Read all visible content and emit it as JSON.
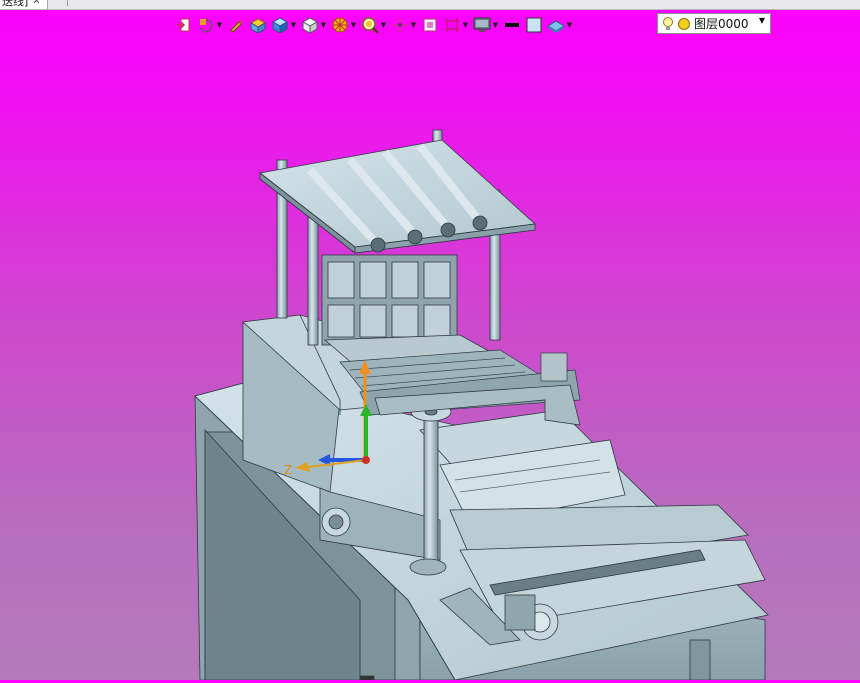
{
  "document_tab": {
    "title": "送线]",
    "close_glyph": "✕"
  },
  "layer_selector": {
    "value": "图层0000"
  },
  "colors": {
    "viewport_top": "#ff00ff",
    "viewport_bottom": "#b47aba",
    "model_light": "#bccfd6",
    "model_mid": "#9fb6bf",
    "model_dark": "#6c8088",
    "axis_x": "#e08a1a",
    "axis_y": "#2bb52b",
    "axis_z": "#2456e0"
  },
  "axis_triad": {
    "x_label": "Z"
  }
}
